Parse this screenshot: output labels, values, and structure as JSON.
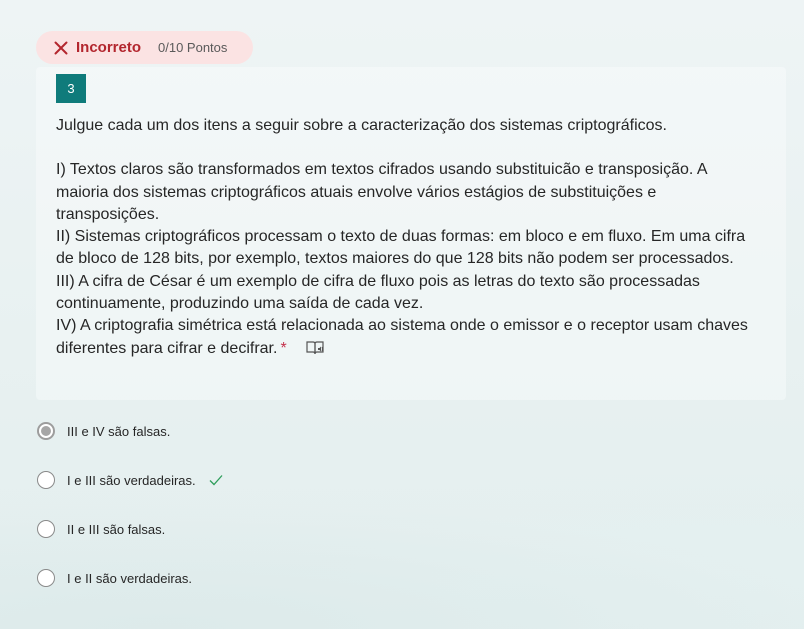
{
  "result": {
    "status": "Incorreto",
    "points": "0/10 Pontos",
    "color": "#b3262e"
  },
  "question": {
    "number": "3",
    "prompt": "Julgue cada um dos itens a seguir sobre a caracterização dos sistemas criptográficos.",
    "item1": "I) Textos claros são transformados em textos cifrados usando substituicão e transposição. A maioria dos sistemas criptográficos atuais envolve vários estágios de substituições e transposições.",
    "item2": "II) Sistemas criptográficos processam o texto de duas formas: em bloco e em fluxo. Em uma cifra de bloco de 128 bits, por exemplo, textos maiores do que 128 bits não podem ser processados.",
    "item3": "III) A cifra de César é um exemplo de cifra de fluxo pois as letras do texto são processadas continuamente, produzindo uma saída de cada vez.",
    "item4": "IV) A criptografia simétrica está relacionada ao sistema onde o emissor e o receptor usam chaves diferentes para cifrar e decifrar.",
    "required_mark": "*",
    "reader_icon": "immersive-reader-icon"
  },
  "options": [
    {
      "label": "III e IV são falsas.",
      "selected": true,
      "correct": false
    },
    {
      "label": "I e III são verdadeiras.",
      "selected": false,
      "correct": true
    },
    {
      "label": "II e III são falsas.",
      "selected": false,
      "correct": false
    },
    {
      "label": "I e II são verdadeiras.",
      "selected": false,
      "correct": false
    }
  ],
  "colors": {
    "accent": "#0f7b7b",
    "incorrect_bg": "#fbe3e3",
    "correct_check": "#2e9e5b"
  }
}
